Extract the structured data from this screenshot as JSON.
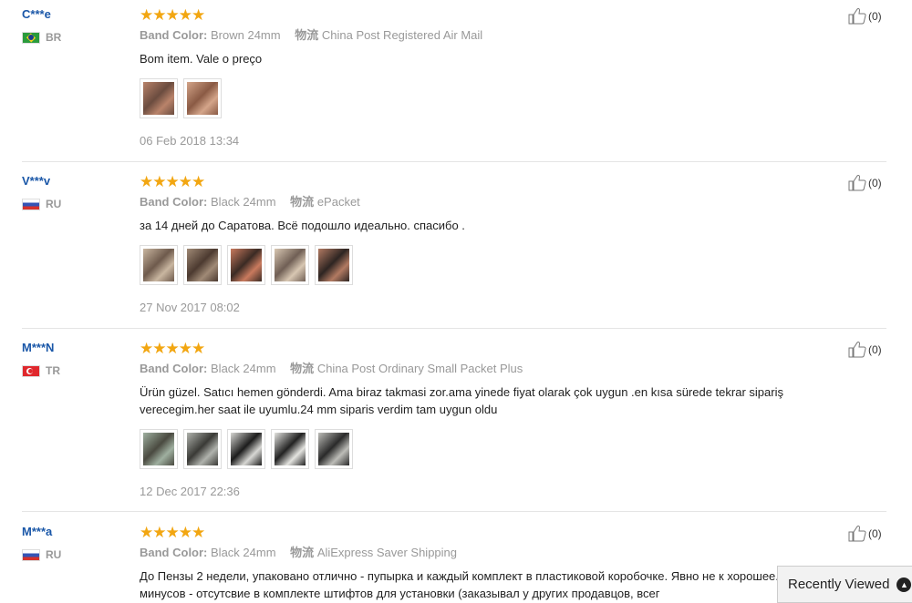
{
  "reviews": [
    {
      "user": "C***e",
      "country": "BR",
      "flag": "br",
      "stars": "★★★★★",
      "band_label": "Band Color:",
      "band_value": "Brown 24mm",
      "logistics_label": "物流",
      "logistics_value": "China Post Registered Air Mail",
      "content": "Bom item. Vale o preço",
      "photo_count": 2,
      "photos": [
        {
          "a": "#6b4c3f",
          "b": "#b9836a"
        },
        {
          "a": "#8a5a44",
          "b": "#d4a58a"
        }
      ],
      "date": "06 Feb 2018 13:34",
      "helpful": "(0)"
    },
    {
      "user": "V***v",
      "country": "RU",
      "flag": "ru",
      "stars": "★★★★★",
      "band_label": "Band Color:",
      "band_value": "Black 24mm",
      "logistics_label": "物流",
      "logistics_value": "ePacket",
      "content": "за 14 дней до Саратова. Всё подошло идеально. спасибо .",
      "photos": [
        {
          "a": "#6e5a4c",
          "b": "#c9b6a0"
        },
        {
          "a": "#4c3a30",
          "b": "#a08a76"
        },
        {
          "a": "#3b2b24",
          "b": "#c97a5e"
        },
        {
          "a": "#705f55",
          "b": "#d8c7b2"
        },
        {
          "a": "#2e2522",
          "b": "#b27a62"
        }
      ],
      "date": "27 Nov 2017 08:02",
      "helpful": "(0)"
    },
    {
      "user": "M***N",
      "country": "TR",
      "flag": "tr",
      "stars": "★★★★★",
      "band_label": "Band Color:",
      "band_value": "Black 24mm",
      "logistics_label": "物流",
      "logistics_value": "China Post Ordinary Small Packet Plus",
      "content": "Ürün güzel. Satıcı hemen gönderdi. Ama biraz takmasi zor.ama yinede fiyat olarak çok uygun .en kısa sürede tekrar sipariş verecegim.her saat ile uyumlu.24 mm siparis verdim tam uygun oldu",
      "photos": [
        {
          "a": "#4a4a40",
          "b": "#9fb0a0"
        },
        {
          "a": "#3a3a36",
          "b": "#b0b3ad"
        },
        {
          "a": "#1c1c1c",
          "b": "#d8d8d4"
        },
        {
          "a": "#222222",
          "b": "#e4e4e0"
        },
        {
          "a": "#2a2a2a",
          "b": "#bdbdb8"
        }
      ],
      "date": "12 Dec 2017 22:36",
      "helpful": "(0)"
    },
    {
      "user": "M***a",
      "country": "RU",
      "flag": "ru",
      "stars": "★★★★★",
      "band_label": "Band Color:",
      "band_value": "Black 24mm",
      "logistics_label": "物流",
      "logistics_value": "AliExpress Saver Shipping",
      "content": "До Пензы 2 недели, упаковано отлично - пупырка и каждый комплект в пластиковой коробочке. Явно не к хорошее. Из минусов - отсутсвие в комплекте штифтов для установки (заказывал у других продавцов, всег",
      "photos": [],
      "date": "",
      "helpful": "(0)"
    }
  ],
  "recently_viewed": {
    "label": "Recently Viewed",
    "icon": "chevron-up-icon"
  },
  "colors": {
    "username": "#1a57a8",
    "star": "#f2a611",
    "meta_text": "#999999"
  }
}
